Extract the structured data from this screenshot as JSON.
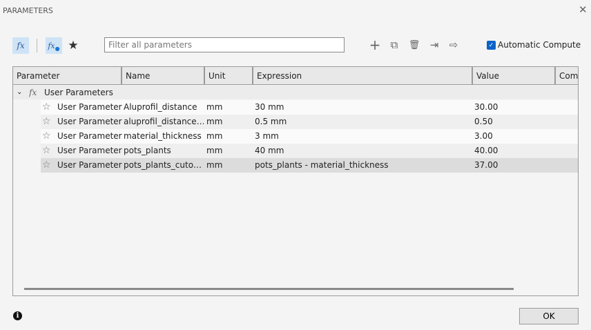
{
  "window": {
    "title": "PARAMETERS",
    "close_icon": "close-icon"
  },
  "toolbar": {
    "fx_label": "fx",
    "user_fx_label": "fx",
    "favorites_icon": "★",
    "filter_placeholder": "Filter all parameters",
    "add_icon": "+",
    "copy_icon": "⧉",
    "delete_icon": "🗑",
    "import_icon": "⇥",
    "export_icon": "⇨",
    "auto_compute_label": "Automatic Compute",
    "auto_compute_checked": true
  },
  "table": {
    "columns": [
      "Parameter",
      "Name",
      "Unit",
      "Expression",
      "Value",
      "Comm"
    ],
    "group_label": "User Parameters",
    "rows": [
      {
        "param": "User Parameter",
        "name": "Aluprofil_distance",
        "unit": "mm",
        "expression": "30 mm",
        "value": "30.00"
      },
      {
        "param": "User Parameter",
        "name": "aluprofil_distance…",
        "unit": "mm",
        "expression": "0.5 mm",
        "value": "0.50"
      },
      {
        "param": "User Parameter",
        "name": "material_thickness",
        "unit": "mm",
        "expression": "3 mm",
        "value": "3.00"
      },
      {
        "param": "User Parameter",
        "name": "pots_plants",
        "unit": "mm",
        "expression": "40 mm",
        "value": "40.00"
      },
      {
        "param": "User Parameter",
        "name": "pots_plants_cuto…",
        "unit": "mm",
        "expression": "pots_plants - material_thickness",
        "value": "37.00"
      }
    ]
  },
  "footer": {
    "ok_label": "OK",
    "info_icon": "i"
  }
}
